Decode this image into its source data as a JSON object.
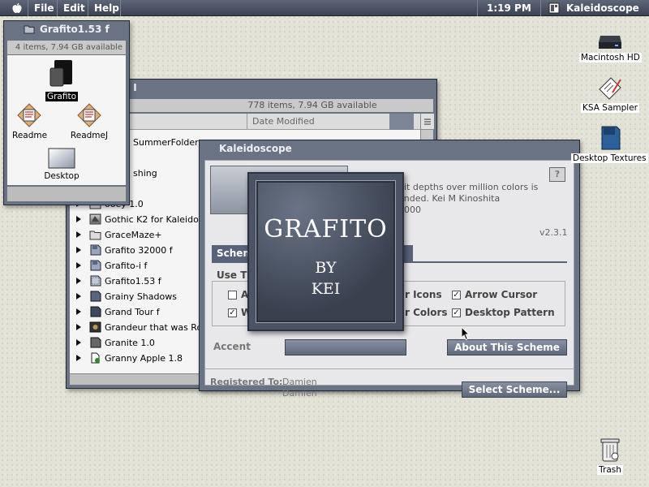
{
  "menubar": {
    "menus": [
      "File",
      "Edit",
      "Help"
    ],
    "clock": "1:19 PM",
    "app": "Kaleidoscope"
  },
  "folder_window": {
    "title": "Grafito1.53 f",
    "info": "4 items, 7.94 GB available",
    "icons": [
      "Grafito",
      "Readme",
      "ReadmeJ",
      "Desktop"
    ]
  },
  "list_window": {
    "title": "H I",
    "info": "778 items, 7.94 GB available",
    "col_date": "Date Modified",
    "partial_rows": [
      "SummerFolder",
      "shing",
      "ooey 1.0"
    ],
    "rows": [
      "Gothic K2 for Kaleidoscope",
      "GraceMaze+",
      "Grafito 32000 f",
      "Grafito-i f",
      "Grafito1.53 f",
      "Grainy Shadows",
      "Grand Tour f",
      "Grandeur that was Rome",
      "Granite 1.0",
      "Granny Apple 1.8"
    ]
  },
  "kaleidoscope": {
    "title": "Kaleidoscope",
    "desc_line1": "bit depths over million colors is",
    "desc_line2": "ended.  Kei M Kinoshita",
    "desc_line3": "2000",
    "version": "v2.3.1",
    "tab_label": "Schem",
    "use_label": "Use Th",
    "opt_left_1": "Al",
    "opt_left_2": "W",
    "opt_mid_1": "r Icons",
    "opt_mid_2": "r Colors",
    "opt_right_1": "Arrow Cursor",
    "opt_right_2": "Desktop Pattern",
    "accent_label": "Accent",
    "about_button": "About This Scheme",
    "registered_label": "Registered To:",
    "registered_name1": "Damien",
    "registered_name2": "Damien",
    "select_button": "Select Scheme..."
  },
  "splash": {
    "title": "GRAFITO",
    "by": "BY",
    "author": "KEI"
  },
  "desktop": {
    "icons": [
      "Macintosh HD",
      "KSA Sampler",
      "Desktop Textures",
      "Trash"
    ]
  }
}
